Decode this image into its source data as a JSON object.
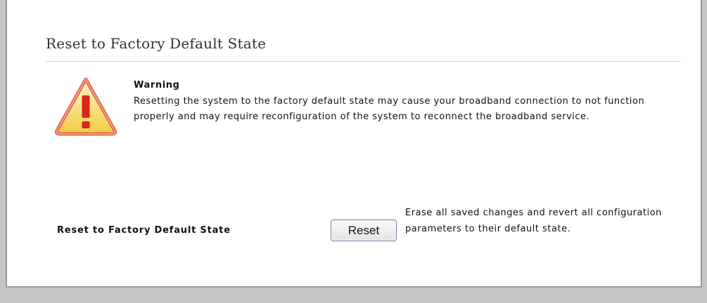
{
  "section": {
    "title": "Reset to Factory Default State"
  },
  "warning": {
    "icon": "warning-triangle-icon",
    "heading": "Warning",
    "text": "Resetting the system to the factory default state may cause your broadband connection to not function properly and may require reconfiguration of the system to reconnect the broadband service."
  },
  "reset": {
    "label": "Reset to Factory Default State",
    "button_label": "Reset",
    "description": "Erase all saved changes and revert all configuration parameters to their default state."
  },
  "colors": {
    "warning_fill": "#f6d64a",
    "warning_border": "#d9503a",
    "exclamation": "#d9261c"
  }
}
